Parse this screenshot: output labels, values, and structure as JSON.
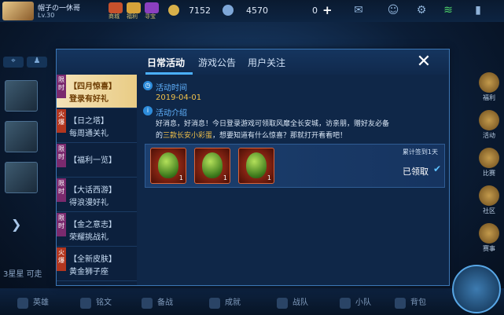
{
  "player": {
    "name": "帽子の一休哥",
    "level": "Lv.30"
  },
  "top_icons": [
    {
      "label": "商城",
      "icon": "shop-icon",
      "color": "#c7512c"
    },
    {
      "label": "福利",
      "icon": "gift-icon",
      "color": "#d6a23a"
    },
    {
      "label": "寻宝",
      "icon": "treasure-icon",
      "color": "#8a3fbf"
    }
  ],
  "currencies": {
    "gold": "7152",
    "coupons": "4570",
    "diamonds": "0"
  },
  "left": {
    "loc_icon": "location-icon",
    "user_icon": "user-icon",
    "arrow": "❯"
  },
  "right_col": [
    {
      "label": "福利"
    },
    {
      "label": "活动"
    },
    {
      "label": "比赛"
    },
    {
      "label": "社区"
    },
    {
      "label": "赛事"
    }
  ],
  "bottom": {
    "stars": "3星星  可走",
    "items": [
      "英雄",
      "铭文",
      "备战",
      "成就",
      "战队",
      "小队",
      "背包"
    ]
  },
  "modal": {
    "tabs": [
      "日常活动",
      "游戏公告",
      "用户关注"
    ],
    "close": "✕",
    "side_items": [
      {
        "badge": "限时",
        "badge_type": "limit",
        "title": "【四月惊喜】",
        "sub": "登录有好礼",
        "active": true
      },
      {
        "badge": "火爆",
        "badge_type": "hot",
        "title": "【日之塔】",
        "sub": "每周通关礼"
      },
      {
        "badge": "限时",
        "badge_type": "limit",
        "title": "【福利一览】",
        "sub": ""
      },
      {
        "badge": "限时",
        "badge_type": "limit",
        "title": "【大话西游】",
        "sub": "得浪漫好礼"
      },
      {
        "badge": "限时",
        "badge_type": "limit",
        "title": "【金之意志】",
        "sub": "荣耀挑战礼"
      },
      {
        "badge": "火爆",
        "badge_type": "hot",
        "title": "【全新皮肤】",
        "sub": "黄金狮子座"
      }
    ],
    "time_label": "活动时间",
    "time_value": "2019-04-01",
    "intro_label": "活动介绍",
    "intro_pre": "好消息，好消息！今日登录游戏可领取风靡全长安城，访亲朋，赠好友必备的",
    "intro_highlight": "三款长安小彩蛋",
    "intro_post": "，想要知道有什么惊喜？那就打开看看吧！",
    "rewards": [
      {
        "count": "1"
      },
      {
        "count": "1"
      },
      {
        "count": "1"
      }
    ],
    "sign_days": "累计签到1天",
    "claimed": "已领取",
    "check": "✔"
  }
}
